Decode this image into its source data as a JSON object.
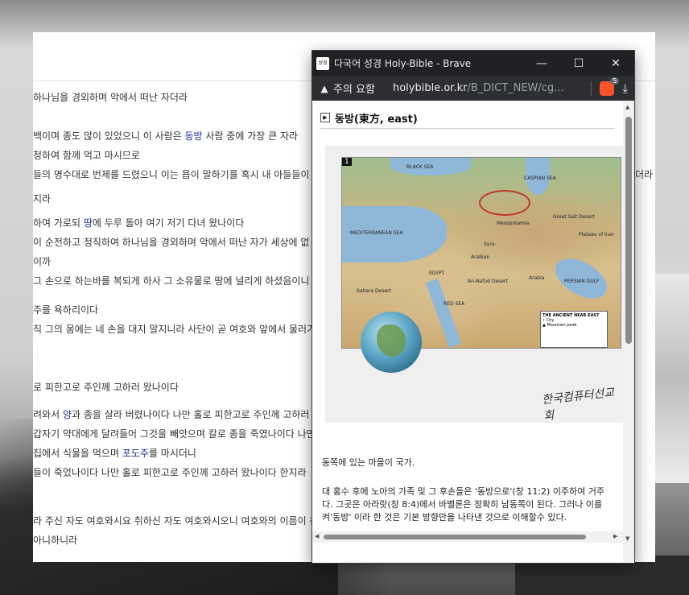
{
  "background_page": {
    "lines": [
      {
        "text": " 하나님을 경외하며 악에서 떠난 자더라"
      },
      {
        "text": "백이며 종도 많이 있었으니 이 사람은 ",
        "hl": "동방",
        "rest": " 사람 중에 가장 큰 자라"
      },
      {
        "text": " 청하여 함께 먹고 마시므로"
      },
      {
        "text": "들의 명수대로 번제를 드렸으니 이는 욥이 말하기를 혹시 내 아들들이"
      },
      {
        "text": "지라"
      },
      {
        "text": "하여 가로되 ",
        "hl": "땅",
        "rest": "에 두루 돌아 여기 저기 다녀 왔나이다"
      },
      {
        "text": "이 순전하고 정직하여 하나님을 경외하며 악에서 떠난 자가 세상에 없"
      },
      {
        "text": "이까"
      },
      {
        "text": " 그 손으로 하는바를 복되게 하사 그 소유물로 땅에 널리게 하셨음이니"
      },
      {
        "text": " 주를 욕하리이다"
      },
      {
        "text": "직 그의 몸에는 네 손을 대지 말지니라 사단이 곧 여호와 앞에서 물러가"
      },
      {
        "text": ""
      },
      {
        "text": "로 피한고로 주인께 고하러 왔나이다"
      },
      {
        "text": "려와서 ",
        "hl": "양",
        "rest": "과 종을 살라 버렸나이다 나만 홀로 피한고로 주인께 고하러 왔"
      },
      {
        "text": " 갑자기 약대에게 달려들어 그것을 빼앗으며 칼로 종을 죽였나이다 나만"
      },
      {
        "text": " 집에서 식물을 먹으며 ",
        "hl": "포도주",
        "rest": "를 마시더니"
      },
      {
        "text": "들이 죽었나이다 나만 홀로 피한고로 주인께 고하러 왔나이다 한지라"
      },
      {
        "text": "라 주신 자도 여호와시요 취하신 자도 여호와시오니 여호와의 이름이 찬"
      },
      {
        "text": " 아니하니라"
      }
    ],
    "right_clip": "더라"
  },
  "window": {
    "title": "다국어 성경 Holy-Bible - Brave",
    "app_icon_text": "성경",
    "warning_label": "주의 요함",
    "url_host": "holybible.or.kr",
    "url_path": "/B_DICT_NEW/cg...",
    "shield_count": "5",
    "buttons": {
      "minimize": "—",
      "maximize": "☐",
      "close": "✕"
    }
  },
  "entry": {
    "heading": "동방(東方, east)",
    "map": {
      "number": "1",
      "legend_title": "THE ANCIENT NEAR EAST",
      "legend_items": [
        "City",
        "Mountain peak"
      ],
      "labels": [
        "BLACK SEA",
        "CASPIAN SEA",
        "MEDITERRANEAN SEA",
        "EGYPT",
        "Arabian",
        "Arabia",
        "Syro-",
        "Sahara Desert",
        "Great Salt Desert",
        "Plateau of Iran",
        "PERSIAN GULF",
        "An-Nafud Desert",
        "RED SEA",
        "Mesopotamia"
      ],
      "watermark": "한국컴퓨터선교회"
    },
    "definition": "동쪽에 있는 마을이 국가.",
    "paragraph_lines": [
      "대 홍수 후에 노아의 가족 및 그 후손들은 '동방으로'(창 11:2) 이주하여 거주",
      "다. 그곳은 아라랏(창 8:4)에서 바벨론은 정확히 남동쪽이 된다. 그러나 이를",
      "켜'동방' 이라 한 것은 기본 방향만을 나타낸 것으로 이해할수 있다."
    ]
  },
  "colors": {
    "title_bar": "#202124",
    "url_bar": "#2d2e31",
    "link": "#1a2a9a",
    "brave": "#fb542b"
  }
}
